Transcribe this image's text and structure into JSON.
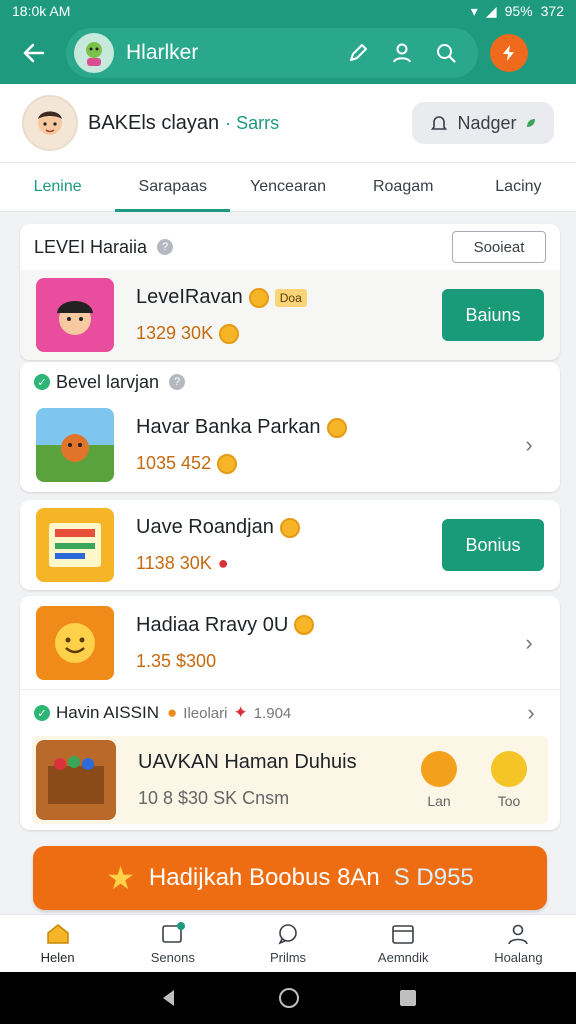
{
  "status_bar": {
    "time": "18:0k AM",
    "battery": "95%",
    "clock_right": "372"
  },
  "app_bar": {
    "title": "Hlarlker"
  },
  "profile": {
    "name": "BAKEls clayan",
    "status": "· Sarrs",
    "nudge_label": "Nadger"
  },
  "tabs": [
    "Lenine",
    "Sarapaas",
    "Yencearan",
    "Roagam",
    "Laciny"
  ],
  "section1": {
    "title": "LEVEI Haraiia",
    "action_label": "Sooieat"
  },
  "items": [
    {
      "title": "LeveIRavan",
      "tag": "Doa",
      "sub": "1329 30K",
      "button": "Baiuns"
    },
    {
      "section_title": "Bevel larvjan",
      "title": "Havar Banka Parkan",
      "sub": "1035 452"
    },
    {
      "title": "Uave Roandjan",
      "sub": "1138 30K",
      "button": "Bonius"
    },
    {
      "title": "Hadiaa Rravy 0U",
      "sub": "1.35 $300"
    }
  ],
  "section3": {
    "title": "Havin AISSIN",
    "meta1": "Ileolari",
    "meta2": "1.904",
    "item": {
      "title": "UAVKAN Haman Duhuis",
      "sub": "10 8 $30 SK Cnsm",
      "mini1": "Lan",
      "mini2": "Too"
    }
  },
  "cta": {
    "text": "Hadijkah Boobus 8An",
    "amount": "S D955"
  },
  "bottom_nav": [
    "Helen",
    "Senons",
    "Prilms",
    "Aemndik",
    "Hoalang"
  ],
  "colors": {
    "primary": "#1e9a7e",
    "accent": "#ef6d12"
  }
}
